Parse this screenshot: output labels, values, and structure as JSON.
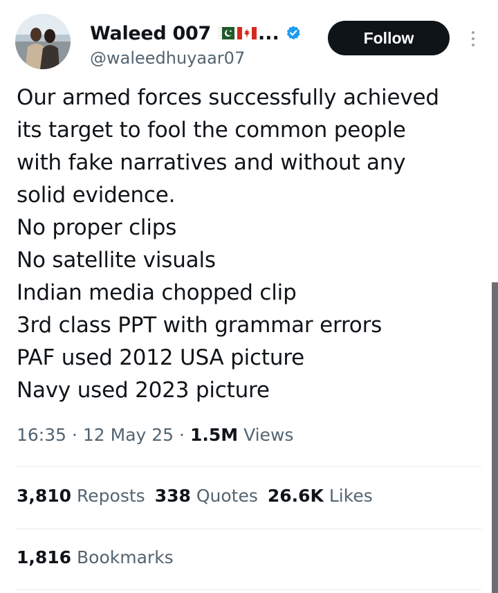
{
  "author": {
    "display_name": "Waleed 007",
    "name_truncation": "...",
    "handle": "@waleedhuyaar07",
    "flags": [
      "pakistan-flag",
      "canada-flag"
    ],
    "verified_icon": "verified-badge-icon",
    "avatar_icon": "avatar-photo"
  },
  "actions": {
    "follow_label": "Follow",
    "more_icon": "more-vertical-icon"
  },
  "tweet": {
    "lines": [
      "Our armed forces successfully achieved",
      "its target to fool the common people",
      "with fake narratives and without any",
      "solid evidence.",
      "No proper clips",
      "No satellite visuals",
      "Indian media chopped clip",
      "3rd class PPT with grammar errors",
      "PAF used 2012 USA picture",
      "Navy used 2023 picture"
    ]
  },
  "meta": {
    "time": "16:35",
    "separator": " · ",
    "date": "12 May 25",
    "views_count": "1.5M",
    "views_label": "Views"
  },
  "stats": {
    "reposts_count": "3,810",
    "reposts_label": "Reposts",
    "quotes_count": "338",
    "quotes_label": "Quotes",
    "likes_count": "26.6K",
    "likes_label": "Likes",
    "bookmarks_count": "1,816",
    "bookmarks_label": "Bookmarks"
  },
  "colors": {
    "text_primary": "#0f1419",
    "text_secondary": "#536471",
    "follow_bg": "#0f1419",
    "verified_blue": "#1d9bf0",
    "divider": "#e6e9eb"
  }
}
